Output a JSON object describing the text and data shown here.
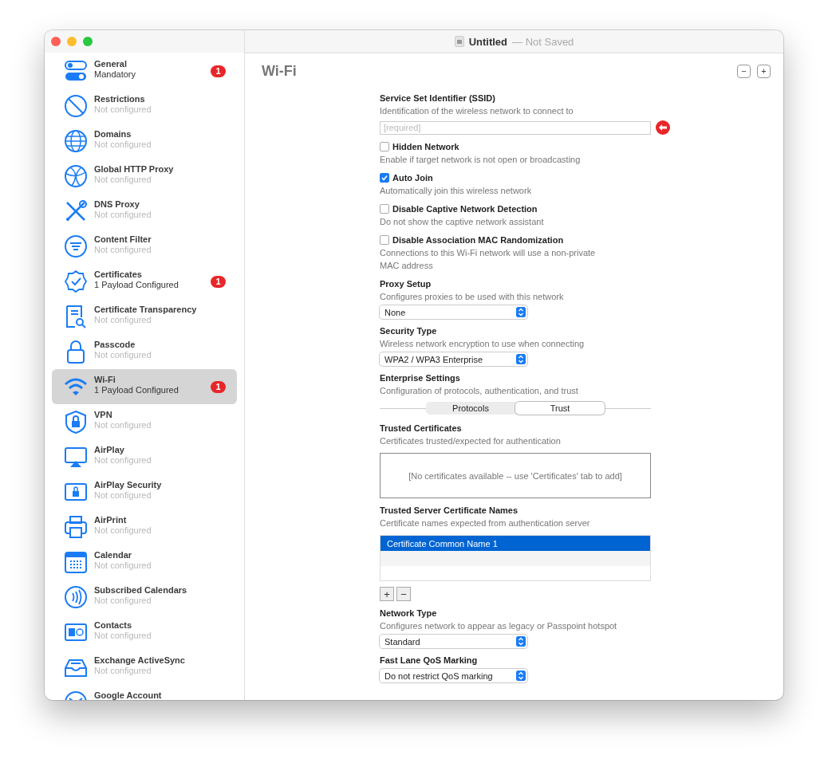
{
  "window": {
    "title": "Untitled",
    "status": "— Not Saved"
  },
  "sidebar": {
    "items": [
      {
        "title": "General",
        "subtitle": "Mandatory",
        "configured": true,
        "badge": "1",
        "selected": false
      },
      {
        "title": "Restrictions",
        "subtitle": "Not configured",
        "configured": false,
        "selected": false
      },
      {
        "title": "Domains",
        "subtitle": "Not configured",
        "configured": false,
        "selected": false
      },
      {
        "title": "Global HTTP Proxy",
        "subtitle": "Not configured",
        "configured": false,
        "selected": false
      },
      {
        "title": "DNS Proxy",
        "subtitle": "Not configured",
        "configured": false,
        "selected": false
      },
      {
        "title": "Content Filter",
        "subtitle": "Not configured",
        "configured": false,
        "selected": false
      },
      {
        "title": "Certificates",
        "subtitle": "1 Payload Configured",
        "configured": true,
        "badge": "1",
        "selected": false
      },
      {
        "title": "Certificate Transparency",
        "subtitle": "Not configured",
        "configured": false,
        "selected": false
      },
      {
        "title": "Passcode",
        "subtitle": "Not configured",
        "configured": false,
        "selected": false
      },
      {
        "title": "Wi-Fi",
        "subtitle": "1 Payload Configured",
        "configured": true,
        "badge": "1",
        "selected": true
      },
      {
        "title": "VPN",
        "subtitle": "Not configured",
        "configured": false,
        "selected": false
      },
      {
        "title": "AirPlay",
        "subtitle": "Not configured",
        "configured": false,
        "selected": false
      },
      {
        "title": "AirPlay Security",
        "subtitle": "Not configured",
        "configured": false,
        "selected": false
      },
      {
        "title": "AirPrint",
        "subtitle": "Not configured",
        "configured": false,
        "selected": false
      },
      {
        "title": "Calendar",
        "subtitle": "Not configured",
        "configured": false,
        "selected": false
      },
      {
        "title": "Subscribed Calendars",
        "subtitle": "Not configured",
        "configured": false,
        "selected": false
      },
      {
        "title": "Contacts",
        "subtitle": "Not configured",
        "configured": false,
        "selected": false
      },
      {
        "title": "Exchange ActiveSync",
        "subtitle": "Not configured",
        "configured": false,
        "selected": false
      },
      {
        "title": "Google Account",
        "selected": false
      }
    ]
  },
  "main": {
    "title": "Wi-Fi",
    "header_buttons": [
      "−",
      "+"
    ],
    "fields": [
      {
        "kind": "text",
        "label": "Service Set Identifier (SSID)",
        "description": "Identification of the wireless network to connect to",
        "placeholder": "[required]",
        "required": true
      },
      {
        "kind": "checkbox",
        "label": "Hidden Network",
        "description": "Enable if target network is not open or broadcasting",
        "checked": false
      },
      {
        "kind": "checkbox",
        "label": "Auto Join",
        "description": "Automatically join this wireless network",
        "checked": true
      },
      {
        "kind": "checkbox",
        "label": "Disable Captive Network Detection",
        "description": "Do not show the captive network assistant",
        "checked": false
      },
      {
        "kind": "checkbox",
        "label": "Disable Association MAC Randomization",
        "description": "Connections to this Wi-Fi network will use a non-private MAC address",
        "checked": false
      },
      {
        "kind": "popup",
        "label": "Proxy Setup",
        "description": "Configures proxies to be used with this network",
        "value": "None"
      },
      {
        "kind": "popup",
        "label": "Security Type",
        "description": "Wireless network encryption to use when connecting",
        "value": "WPA2 / WPA3 Enterprise"
      },
      {
        "kind": "segmented",
        "label": "Enterprise Settings",
        "description": "Configuration of protocols, authentication, and trust",
        "segments": [
          {
            "label": "Protocols",
            "selected": false
          },
          {
            "label": "Trust",
            "selected": true
          }
        ]
      },
      {
        "kind": "box",
        "label": "Trusted Certificates",
        "description": "Certificates trusted/expected for authentication",
        "text": "[No certificates available -- use 'Certificates' tab to add]"
      },
      {
        "kind": "list",
        "label": "Trusted Server Certificate Names",
        "description": "Certificate names expected from authentication server",
        "rows": [
          {
            "text": "Certificate Common Name 1",
            "selected": true
          }
        ],
        "buttons": [
          "+",
          "−"
        ]
      },
      {
        "kind": "popup",
        "label": "Network Type",
        "description": "Configures network to appear as legacy or Passpoint hotspot",
        "value": "Standard"
      },
      {
        "kind": "popup",
        "label": "Fast Lane QoS Marking",
        "value": "Do not restrict QoS marking"
      }
    ]
  }
}
